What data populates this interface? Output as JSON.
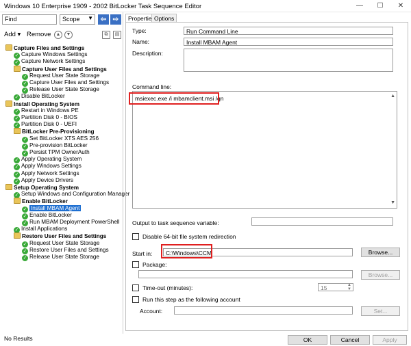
{
  "window": {
    "title": "Windows 10 Enterprise 1909 - 2002 BitLocker Task Sequence Editor",
    "minimize": "—",
    "maximize": "☐",
    "close": "✕"
  },
  "search": {
    "value": "Find",
    "scope": "Scope",
    "prev": "⇦",
    "next": "⇨"
  },
  "toolbar": {
    "add": "Add",
    "remove": "Remove"
  },
  "tree": [
    {
      "label": "Capture Files and Settings",
      "type": "group"
    },
    {
      "label": "Capture Windows Settings",
      "type": "step"
    },
    {
      "label": "Capture Network Settings",
      "type": "step"
    },
    {
      "label": "Capture User Files and Settings",
      "type": "group"
    },
    {
      "label": "Request User State Storage",
      "type": "step"
    },
    {
      "label": "Capture User Files and Settings",
      "type": "step"
    },
    {
      "label": "Release User State Storage",
      "type": "step"
    },
    {
      "label": "Disable BitLocker",
      "type": "step"
    },
    {
      "label": "Install Operating System",
      "type": "group"
    },
    {
      "label": "Restart in Windows PE",
      "type": "step"
    },
    {
      "label": "Partition Disk 0 - BIOS",
      "type": "step"
    },
    {
      "label": "Partition Disk 0 - UEFI",
      "type": "step"
    },
    {
      "label": "BitLocker Pre-Provisioning",
      "type": "group"
    },
    {
      "label": "Set BitLocker XTS AES 256",
      "type": "step"
    },
    {
      "label": "Pre-provision BitLocker",
      "type": "step"
    },
    {
      "label": "Persist TPM OwnerAuth",
      "type": "step"
    },
    {
      "label": "Apply Operating System",
      "type": "step"
    },
    {
      "label": "Apply Windows Settings",
      "type": "step"
    },
    {
      "label": "Apply Network Settings",
      "type": "step"
    },
    {
      "label": "Apply Device Drivers",
      "type": "step"
    },
    {
      "label": "Setup Operating System",
      "type": "group"
    },
    {
      "label": "Setup Windows and Configuration Manager",
      "type": "step"
    },
    {
      "label": "Enable BitLocker",
      "type": "group"
    },
    {
      "label": "Install MBAM Agent",
      "type": "step",
      "selected": true
    },
    {
      "label": "Enable BitLocker",
      "type": "step"
    },
    {
      "label": "Run MBAM Deployment PowerShell",
      "type": "step"
    },
    {
      "label": "Install Applications",
      "type": "step"
    },
    {
      "label": "Restore User Files and Settings",
      "type": "group"
    },
    {
      "label": "Request User State Storage",
      "type": "step"
    },
    {
      "label": "Restore User Files and Settings",
      "type": "step"
    },
    {
      "label": "Release User State Storage",
      "type": "step"
    }
  ],
  "status": "No Results",
  "tabs": {
    "properties": "Properties",
    "options": "Options"
  },
  "form": {
    "type_label": "Type:",
    "type_value": "Run Command Line",
    "name_label": "Name:",
    "name_value": "Install MBAM Agent",
    "description_label": "Description:",
    "commandline_label": "Command line:",
    "commandline_value": "msiexec.exe /i mbamclient.msi /qn",
    "output_label": "Output to task sequence variable:",
    "disable64_label": "Disable 64-bit file system redirection",
    "startin_label": "Start in:",
    "startin_value": "C:\\Windows\\CCM",
    "browse": "Browse...",
    "package_label": "Package:",
    "browse2": "Browse...",
    "timeout_label": "Time-out (minutes):",
    "timeout_value": "15",
    "runas_label": "Run this step as the following account",
    "account_label": "Account:",
    "set_label": "Set..."
  },
  "footer": {
    "ok": "OK",
    "cancel": "Cancel",
    "apply": "Apply"
  },
  "colors": {
    "accent": "#1e6fd1",
    "highlight": "#e01f1f",
    "check": "#39a938",
    "folder": "#e9c55a"
  }
}
